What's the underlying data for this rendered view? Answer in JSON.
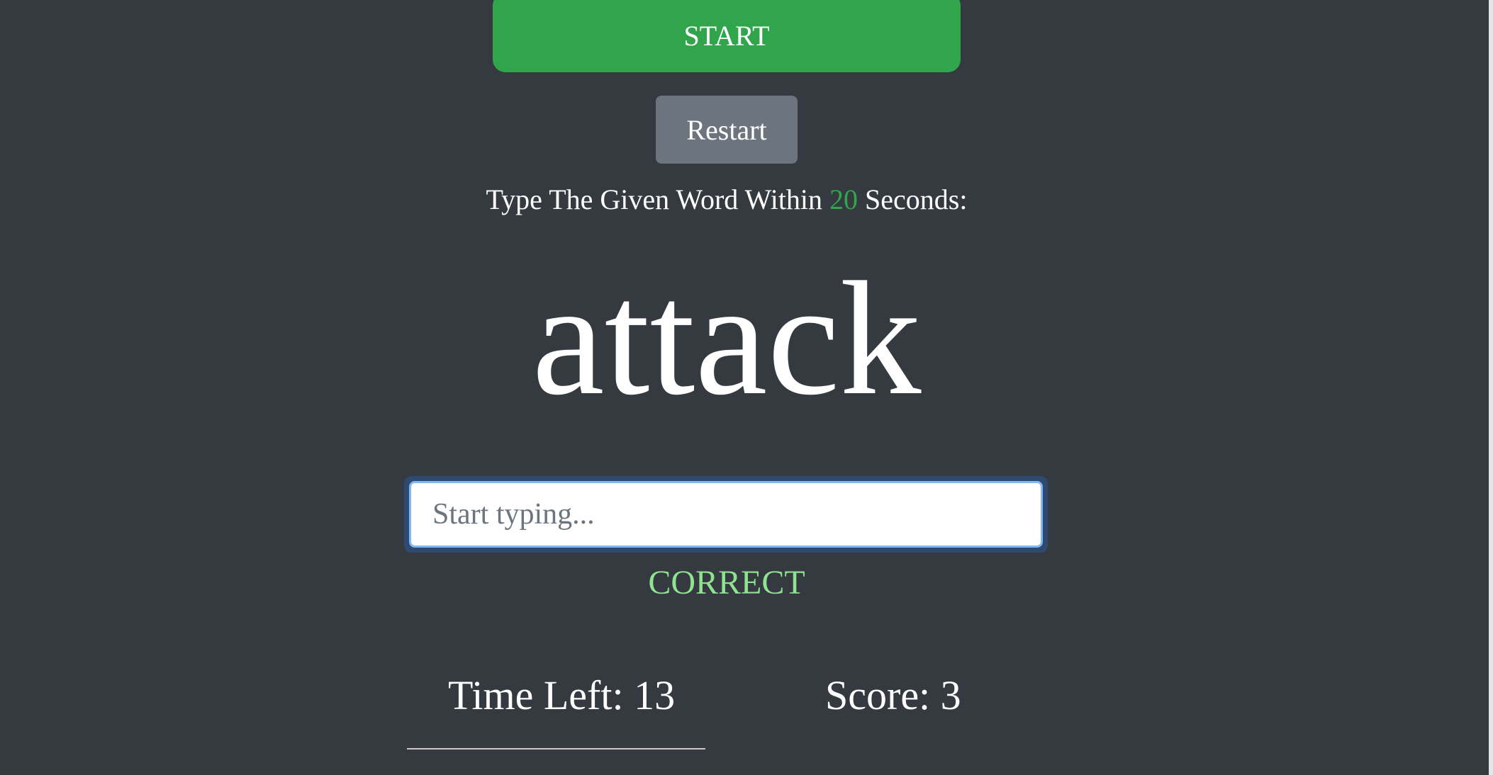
{
  "buttons": {
    "start_label": "START",
    "restart_label": "Restart"
  },
  "instruction": {
    "prefix": "Type The Given Word Within",
    "seconds": "20",
    "suffix": "Seconds:"
  },
  "current_word": "attack",
  "input": {
    "value": "",
    "placeholder": "Start typing..."
  },
  "message": "CORRECT",
  "stats": {
    "time_left_label": "Time Left: 13",
    "score_label": "Score: 3"
  },
  "colors": {
    "background": "#343a40",
    "start": "#30a54c",
    "restart": "#6c757d",
    "correct": "#8fe28f"
  }
}
